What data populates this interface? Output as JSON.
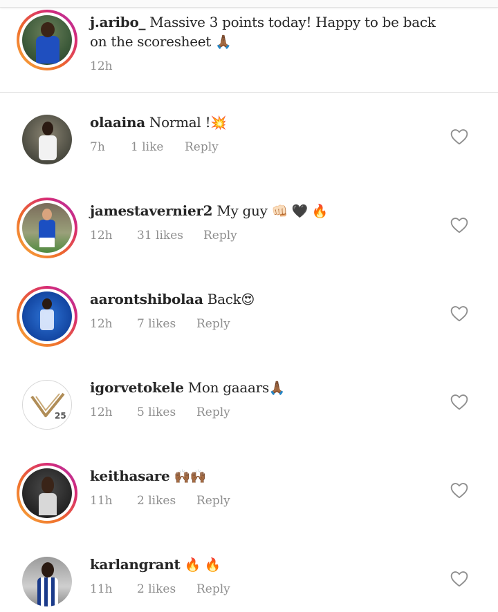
{
  "caption": {
    "username": "j.aribo_",
    "text": "Massive 3 points today! Happy to be back on the scoresheet",
    "emoji": "🙏🏾",
    "time": "12h"
  },
  "comments": [
    {
      "username": "olaaina",
      "text": "Normal !",
      "emoji": "💥",
      "time": "7h",
      "likes": "1 like",
      "reply": "Reply"
    },
    {
      "username": "jamestavernier2",
      "text": "My guy",
      "emoji": "👊🏻 🖤 🔥",
      "time": "12h",
      "likes": "31 likes",
      "reply": "Reply"
    },
    {
      "username": "aarontshibolaa",
      "text": "Back",
      "emoji": "😍",
      "time": "12h",
      "likes": "7 likes",
      "reply": "Reply"
    },
    {
      "username": "igorvetokele",
      "text": "Mon gaaars",
      "emoji": "🙏🏾",
      "time": "12h",
      "likes": "5 likes",
      "reply": "Reply",
      "avatar_text": "25"
    },
    {
      "username": "keithasare",
      "text": "",
      "emoji": "🙌🏾🙌🏾",
      "time": "11h",
      "likes": "2 likes",
      "reply": "Reply"
    },
    {
      "username": "karlangrant",
      "text": "",
      "emoji": "🔥 🔥",
      "time": "11h",
      "likes": "2 likes",
      "reply": "Reply"
    }
  ],
  "icons": {
    "like": "heart-outline-icon"
  },
  "colors": {
    "text": "#262626",
    "muted": "#8e8e8e",
    "story_ring_start": "#f9ae3d",
    "story_ring_end": "#a63bb5"
  }
}
